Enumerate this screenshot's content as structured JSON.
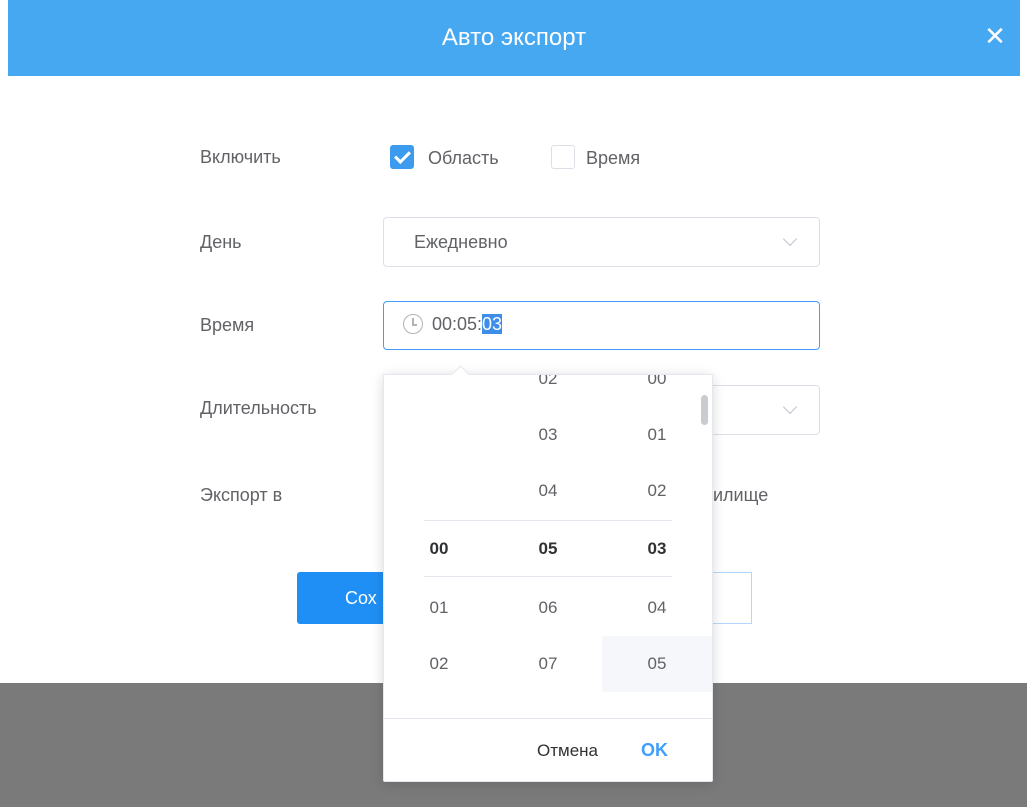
{
  "dialog": {
    "title": "Авто экспорт",
    "close_glyph": "✕"
  },
  "form": {
    "enable_label": "Включить",
    "enable_options": [
      {
        "label": "Область",
        "checked": true
      },
      {
        "label": "Время",
        "checked": false
      }
    ],
    "day_label": "День",
    "day_value": "Ежедневно",
    "time_label": "Время",
    "time_prefix": "00:05:",
    "time_selected": "03",
    "duration_label": "Длительность",
    "export_label": "Экспорт в",
    "export_value_fragment": "илище",
    "save_label_fragment": "Сох"
  },
  "picker": {
    "hours": [
      "",
      "",
      "",
      "00",
      "01",
      "02",
      ""
    ],
    "minutes": [
      "02",
      "03",
      "04",
      "05",
      "06",
      "07",
      ""
    ],
    "seconds": [
      "00",
      "01",
      "02",
      "03",
      "04",
      "05",
      ""
    ],
    "hover_second": "05",
    "cancel_label": "Отмена",
    "ok_label": "OK"
  },
  "colors": {
    "title_bar": "#45a8f0",
    "accent": "#409eff",
    "overlay": "#7a7a7a"
  }
}
